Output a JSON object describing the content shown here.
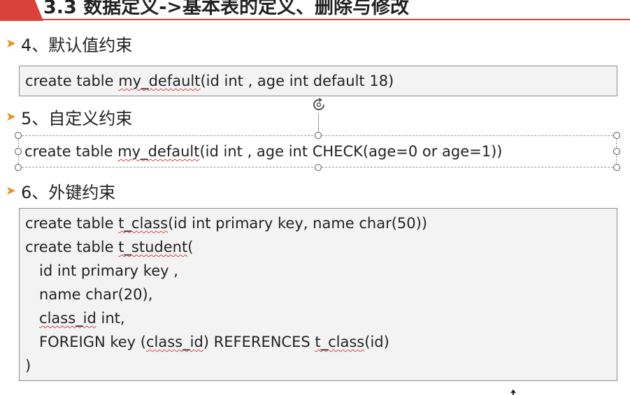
{
  "slide": {
    "title": "3.3 数据定义->基本表的定义、删除与修改"
  },
  "sections": [
    {
      "heading": "4、默认值约束",
      "code": [
        [
          {
            "t": "create table "
          },
          {
            "t": "my_default",
            "sq": true
          },
          {
            "t": "(id int , age int default 18)"
          }
        ]
      ]
    },
    {
      "heading": "5、自定义约束",
      "code": [
        [
          {
            "t": "create table "
          },
          {
            "t": "my_default",
            "sq": true
          },
          {
            "t": "(id int , age int CHECK(age=0 or age=1))"
          }
        ]
      ]
    },
    {
      "heading": "6、外键约束",
      "code": [
        [
          {
            "t": "create table "
          },
          {
            "t": "t_class",
            "sq": true
          },
          {
            "t": "(id int primary key, name char(50))"
          }
        ],
        [
          {
            "t": "create table "
          },
          {
            "t": "t_student",
            "sq": true
          },
          {
            "t": "("
          }
        ],
        [
          {
            "t": "   id int primary key ,"
          }
        ],
        [
          {
            "t": "   name char(20),"
          }
        ],
        [
          {
            "t": "   "
          },
          {
            "t": "class_id",
            "sq": true
          },
          {
            "t": " int,"
          }
        ],
        [
          {
            "t": "   FOREIGN key ("
          },
          {
            "t": "class_id",
            "sq": true
          },
          {
            "t": ") REFERENCES "
          },
          {
            "t": "t_class",
            "sq": true
          },
          {
            "t": "(id)"
          }
        ],
        [
          {
            "t": ")"
          }
        ]
      ]
    }
  ],
  "icons": {
    "bullet": "triangle-arrow-icon",
    "rotate": "rotate-handle-icon",
    "cursor": "mouse-cursor-icon"
  },
  "colors": {
    "accent": "#d9423b",
    "bullet": "#e8922b",
    "code_background": "#f3f3f3",
    "spellcheck": "#d64545"
  }
}
